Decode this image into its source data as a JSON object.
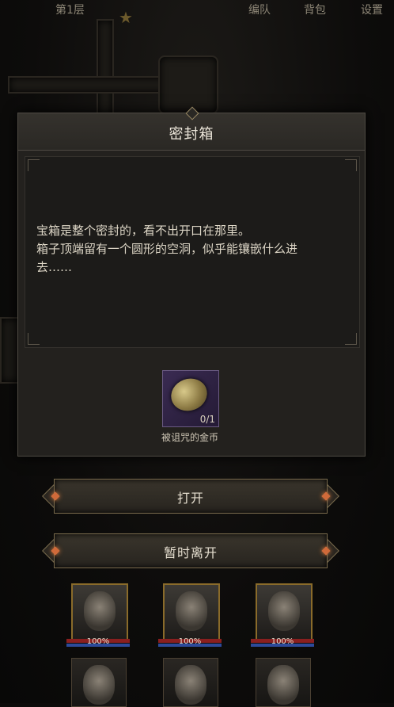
{
  "topbar": {
    "left_label": "第1层",
    "team_label": "编队",
    "bag_label": "背包",
    "settings_label": "设置"
  },
  "dialog": {
    "title": "密封箱",
    "description_lines": [
      "宝箱是整个密封的，看不出开口在那里。",
      "箱子顶端留有一个圆形的空洞，似乎能镶嵌什么进",
      "去……"
    ],
    "item": {
      "name": "被诅咒的金币",
      "count": "0/1"
    }
  },
  "buttons": {
    "open_label": "打开",
    "leave_label": "暂时离开"
  },
  "party": {
    "heroes": [
      {
        "hp_text": "100%",
        "hp": 1.0
      },
      {
        "hp_text": "100%",
        "hp": 1.0
      },
      {
        "hp_text": "100%",
        "hp": 1.0
      }
    ]
  },
  "colors": {
    "accent_gem": "#d06a3a",
    "frame_gold": "#8a6b2a",
    "hp_red": "#8a1f1f",
    "mp_blue": "#2d4a9a"
  }
}
